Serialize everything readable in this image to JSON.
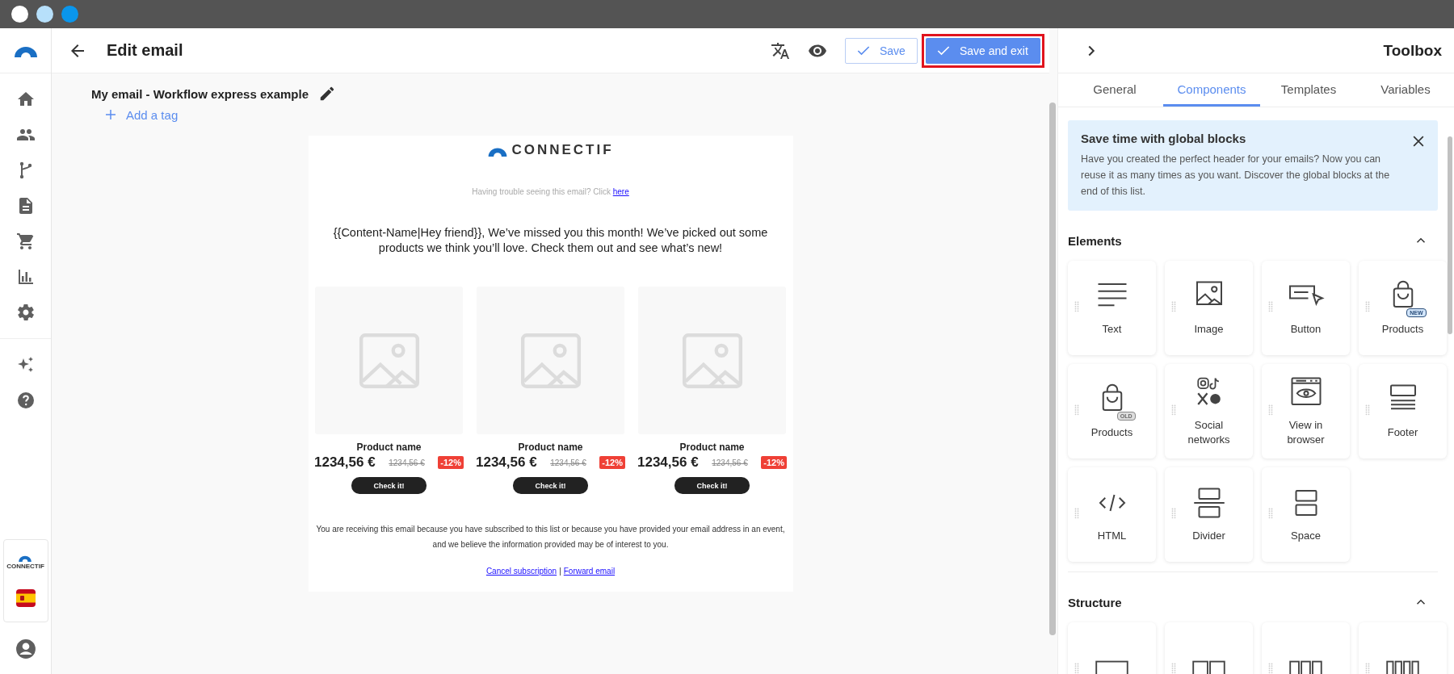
{
  "header": {
    "title": "Edit email",
    "save_button": "Save",
    "save_exit_button": "Save and exit",
    "save_exit_highlighted": true
  },
  "sidebar": {
    "brand_text": "CONNECTIF"
  },
  "email_name": "My email - Workflow express example",
  "add_tag": "Add a tag",
  "email": {
    "brand": "CONNECTIF",
    "trouble_text": "Having trouble seeing this email? Click",
    "trouble_link": "here",
    "intro": "{{Content-Name|Hey friend}}, We’ve missed you this month! We’ve picked out some products we think you’ll love. Check them out and see what’s new!",
    "products": [
      {
        "name": "Product name",
        "price": "1234,56 €",
        "old_price": "1234,56 €",
        "discount": "-12%",
        "button": "Check it!"
      },
      {
        "name": "Product name",
        "price": "1234,56 €",
        "old_price": "1234,56 €",
        "discount": "-12%",
        "button": "Check it!"
      },
      {
        "name": "Product name",
        "price": "1234,56 €",
        "old_price": "1234,56 €",
        "discount": "-12%",
        "button": "Check it!"
      }
    ],
    "footer_text": "You are receiving this email because you have subscribed to this list or because you have provided your email address in an event, and we believe the information provided may be of interest to you.",
    "footer_links": [
      "Cancel subscription",
      "Forward email"
    ],
    "footer_separator": "|"
  },
  "toolbox": {
    "title": "Toolbox",
    "tabs": [
      {
        "label": "General",
        "selected": false
      },
      {
        "label": "Components",
        "selected": true
      },
      {
        "label": "Templates",
        "selected": false
      },
      {
        "label": "Variables",
        "selected": false
      }
    ],
    "notice": {
      "title": "Save time with global blocks",
      "body": "Have you created the perfect header for your emails? Now you can reuse it as many times as you want. Discover the global blocks at the end of this list."
    },
    "sections": [
      {
        "title": "Elements",
        "expanded": true,
        "items": [
          {
            "kind": "text",
            "label": "Text"
          },
          {
            "kind": "image",
            "label": "Image"
          },
          {
            "kind": "button",
            "label": "Button"
          },
          {
            "kind": "bag",
            "label": "Products",
            "badge": "NEW"
          },
          {
            "kind": "bag",
            "label": "Products",
            "badge": "OLD"
          },
          {
            "kind": "social",
            "label": "Social networks"
          },
          {
            "kind": "browser",
            "label": "View in browser"
          },
          {
            "kind": "footer",
            "label": "Footer"
          },
          {
            "kind": "html",
            "label": "HTML"
          },
          {
            "kind": "divider",
            "label": "Divider"
          },
          {
            "kind": "space",
            "label": "Space"
          }
        ]
      },
      {
        "title": "Structure",
        "expanded": true,
        "items": [
          {
            "kind": "columns1"
          },
          {
            "kind": "columns2"
          },
          {
            "kind": "columns3"
          },
          {
            "kind": "columns4"
          }
        ]
      }
    ]
  }
}
